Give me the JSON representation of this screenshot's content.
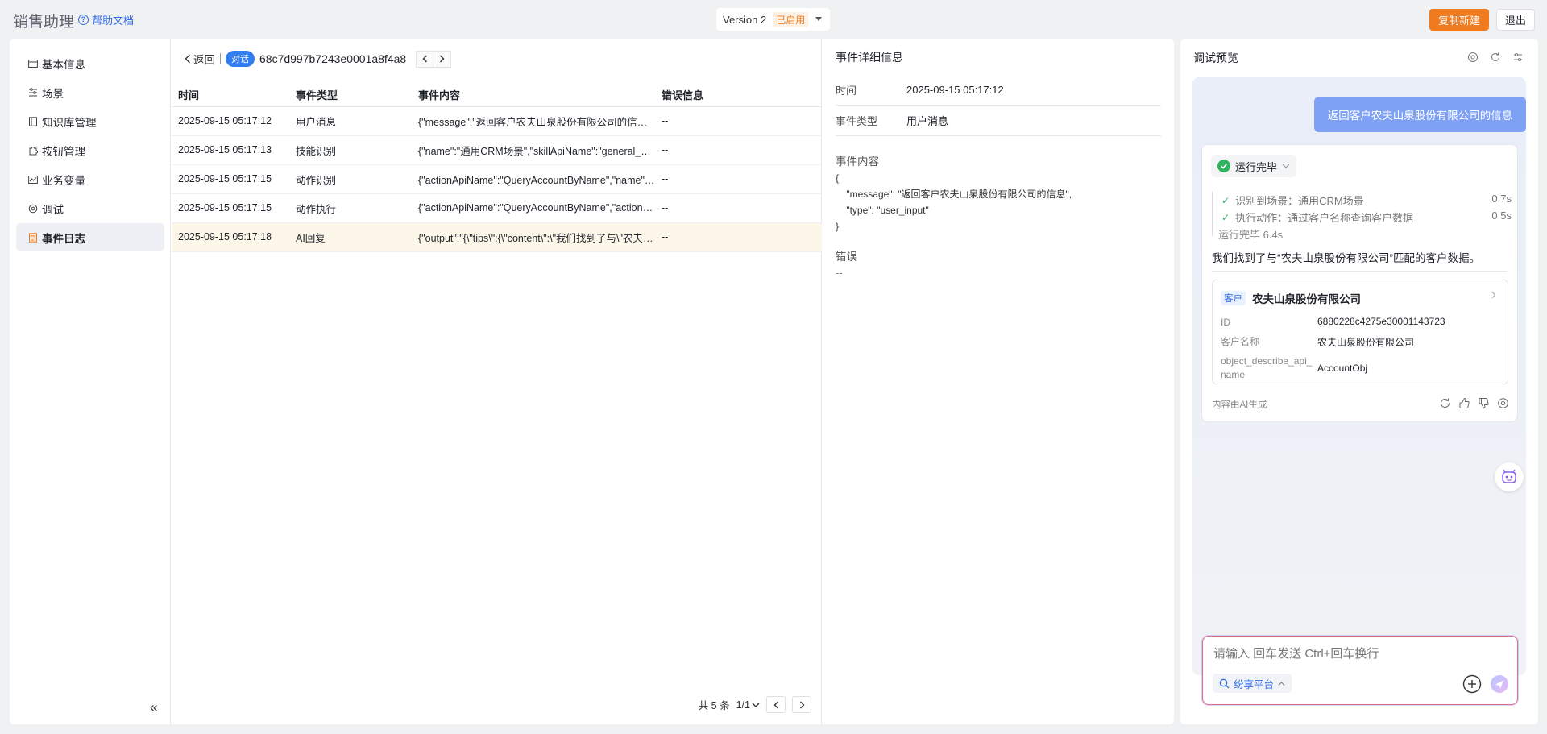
{
  "header": {
    "app_title": "销售助理",
    "help_label": "帮助文档",
    "version_label": "Version 2",
    "version_status": "已启用",
    "copy_new_label": "复制新建",
    "exit_label": "退出"
  },
  "sidebar": {
    "items": [
      {
        "label": "基本信息",
        "icon": "info-card-icon"
      },
      {
        "label": "场景",
        "icon": "scene-list-icon"
      },
      {
        "label": "知识库管理",
        "icon": "book-icon"
      },
      {
        "label": "按钮管理",
        "icon": "puzzle-icon"
      },
      {
        "label": "业务变量",
        "icon": "chart-icon"
      },
      {
        "label": "调试",
        "icon": "gear-icon"
      },
      {
        "label": "事件日志",
        "icon": "log-icon"
      }
    ],
    "active_index": 6
  },
  "events": {
    "back_label": "返回",
    "tag_label": "对话",
    "conversation_id": "68c7d997b7243e0001a8f4a8",
    "columns": [
      "时间",
      "事件类型",
      "事件内容",
      "错误信息"
    ],
    "rows": [
      {
        "time": "2025-09-15 05:17:12",
        "type": "用户消息",
        "content": "{\"message\":\"返回客户农夫山泉股份有限公司的信息\",\"type\":\"user_input\"}",
        "error": "--"
      },
      {
        "time": "2025-09-15 05:17:13",
        "type": "技能识别",
        "content": "{\"name\":\"通用CRM场景\",\"skillApiName\":\"general_crm\"}",
        "error": "--"
      },
      {
        "time": "2025-09-15 05:17:15",
        "type": "动作识别",
        "content": "{\"actionApiName\":\"QueryAccountByName\",\"name\":\"通过客户名称查询客户数据\"}",
        "error": "--"
      },
      {
        "time": "2025-09-15 05:17:15",
        "type": "动作执行",
        "content": "{\"actionApiName\":\"QueryAccountByName\",\"action\":\"execute\"}",
        "error": "--"
      },
      {
        "time": "2025-09-15 05:17:18",
        "type": "AI回复",
        "content": "{\"output\":\"{\\\"tips\\\":{\\\"content\\\":\\\"我们找到了与\\\"农夫山泉\\\"}}\"}",
        "error": "--"
      }
    ],
    "selected_index": 4,
    "footer_total": "共 5 条",
    "footer_page": "1/1"
  },
  "detail": {
    "title": "事件详细信息",
    "time_label": "时间",
    "time_value": "2025-09-15 05:17:12",
    "type_label": "事件类型",
    "type_value": "用户消息",
    "content_label": "事件内容",
    "json_lines": [
      "{",
      "    \"message\": \"返回客户农夫山泉股份有限公司的信息\",",
      "    \"type\": \"user_input\"",
      "}"
    ],
    "error_label": "错误",
    "error_value": "--"
  },
  "debug": {
    "title": "调试预览",
    "user_message": "返回客户农夫山泉股份有限公司的信息",
    "status_label": "运行完毕",
    "steps": [
      {
        "label": "识别到场景：通用CRM场景",
        "time": "0.7s"
      },
      {
        "label": "执行动作：通过客户名称查询客户数据",
        "time": "0.5s"
      }
    ],
    "done_label": "运行完毕 6.4s",
    "answer": "我们找到了与“农夫山泉股份有限公司”匹配的客户数据。",
    "account": {
      "tag": "客户",
      "name": "农夫山泉股份有限公司",
      "fields": [
        {
          "key": "ID",
          "value": "6880228c4275e30001143723"
        },
        {
          "key": "客户名称",
          "value": "农夫山泉股份有限公司"
        },
        {
          "key": "object_describe_api_name",
          "value": "AccountObj"
        }
      ]
    },
    "ai_note": "内容由AI生成",
    "input_placeholder": "请输入 回车发送 Ctrl+回车换行",
    "platform_label": "纷享平台"
  },
  "colors": {
    "accent": "#2f7df0",
    "orange": "#f07b1f",
    "success": "#2fb55d",
    "selected_row": "#fdf7ea"
  }
}
